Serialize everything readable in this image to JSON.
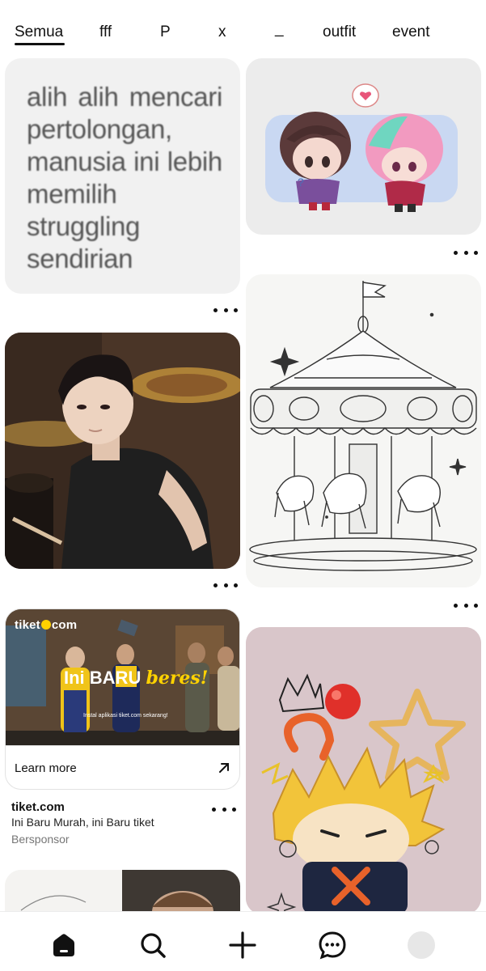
{
  "tabs": [
    {
      "label": "Semua",
      "active": true
    },
    {
      "label": "fff"
    },
    {
      "label": "P"
    },
    {
      "label": "x"
    },
    {
      "label": "_"
    },
    {
      "label": "outfit"
    },
    {
      "label": "event"
    }
  ],
  "pins": {
    "text_card": {
      "quote": "alih alih mencari pertolongan, manusia ini lebih memilih struggling sendirian"
    },
    "chibi": {
      "icon": "chibi-illustration"
    },
    "man": {
      "icon": "photo-man-drums"
    },
    "carousel": {
      "icon": "carousel-sketch"
    },
    "keychain": {
      "icon": "keychain-photo"
    },
    "partial": {
      "icon": "sketch-photo"
    }
  },
  "ad": {
    "brand_left": "tiket",
    "brand_right": "com",
    "headline_main": "Ini BARU",
    "headline_highlight": "beres!",
    "subline": "Instal aplikasi tiket.com sekarang!",
    "cta_label": "Learn more",
    "title": "tiket.com",
    "description": "Ini Baru Murah, ini Baru tiket",
    "sponsor_label": "Bersponsor",
    "accent_color": "#ffd200"
  },
  "bottom_nav": {
    "items": [
      "home-icon",
      "search-icon",
      "create-icon",
      "messages-icon",
      "profile-avatar"
    ]
  }
}
